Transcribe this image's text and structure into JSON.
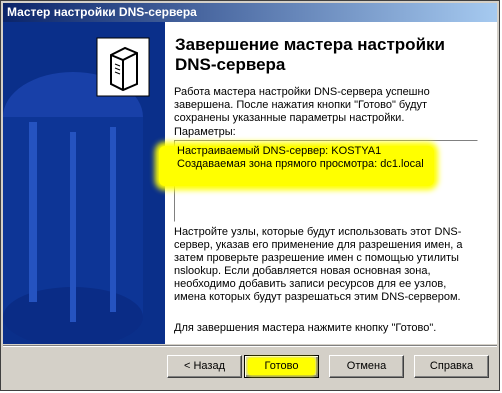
{
  "window": {
    "title": "Мастер настройки DNS-сервера"
  },
  "banner": {
    "icon": "server-icon",
    "background": "#0a2f8a"
  },
  "content": {
    "heading": "Завершение мастера настройки DNS-сервера",
    "intro": "Работа мастера настройки DNS-сервера успешно завершена. После нажатия кнопки \"Готово\" будут сохранены указанные параметры настройки.",
    "params_label": "Параметры:",
    "params": [
      "Настраиваемый DNS-сервер: KOSTYA1",
      "Создаваемая зона прямого просмотра: dc1.local"
    ],
    "body": "Настройте узлы, которые будут использовать этот DNS-сервер, указав его применение для разрешения имен, а затем проверьте разрешение имен с помощью утилиты nslookup. Если добавляется новая основная зона, необходимо добавить записи ресурсов для ее узлов, имена которых будут разрешаться этим DNS-сервером.",
    "finish": "Для завершения мастера нажмите кнопку \"Готово\"."
  },
  "buttons": {
    "back": "< Назад",
    "finish": "Готово",
    "cancel": "Отмена",
    "help": "Справка"
  },
  "colors": {
    "highlight": "#ffff00",
    "titlebar": "#0a246a"
  }
}
